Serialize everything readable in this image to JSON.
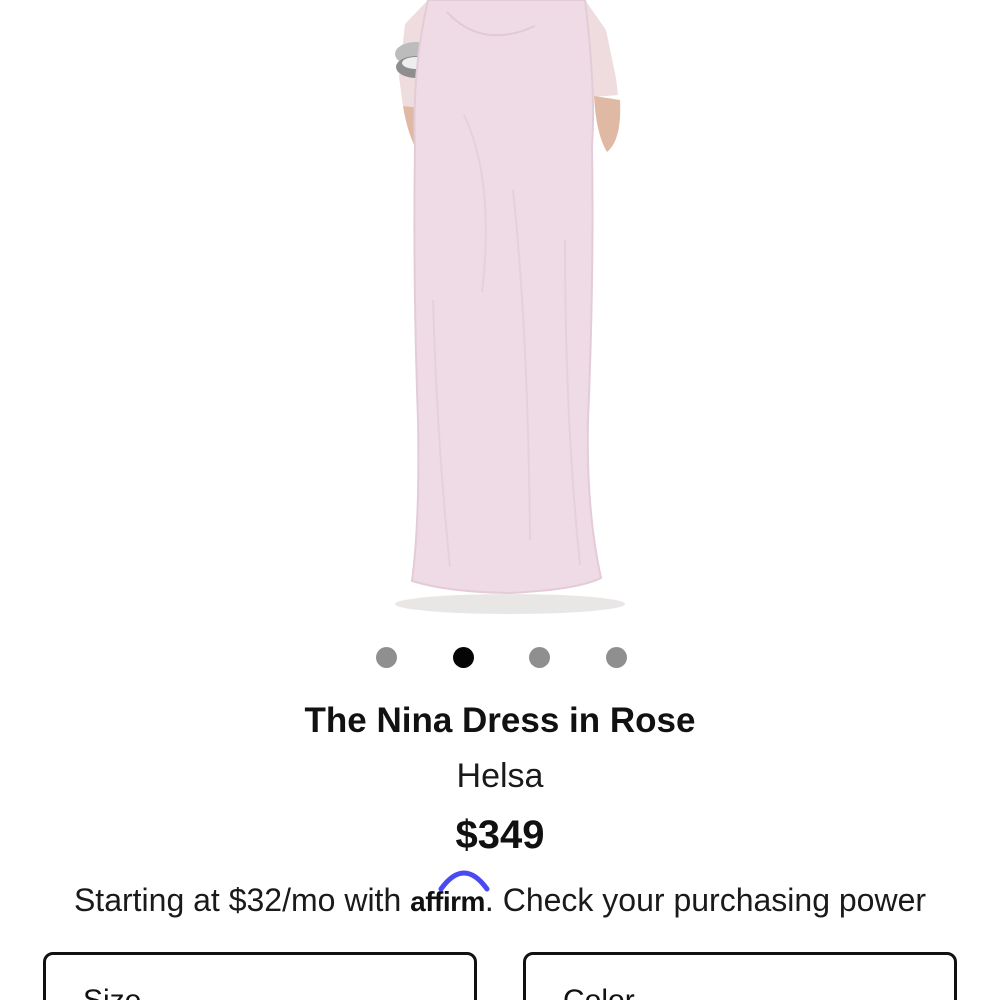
{
  "product": {
    "title": "The Nina Dress in Rose",
    "brand": "Helsa",
    "price": "$349"
  },
  "carousel": {
    "total": 4,
    "active_index": 1
  },
  "financing": {
    "prefix": "Starting at $32/mo with",
    "provider": "affirm",
    "suffix": ". Check your purchasing power"
  },
  "options": {
    "size_label": "Size",
    "color_label": "Color"
  },
  "colors": {
    "dress": "#efdbe5",
    "affirm_accent": "#4a4af4",
    "active_dot": "#050505",
    "inactive_dot": "#8f8f8f"
  }
}
